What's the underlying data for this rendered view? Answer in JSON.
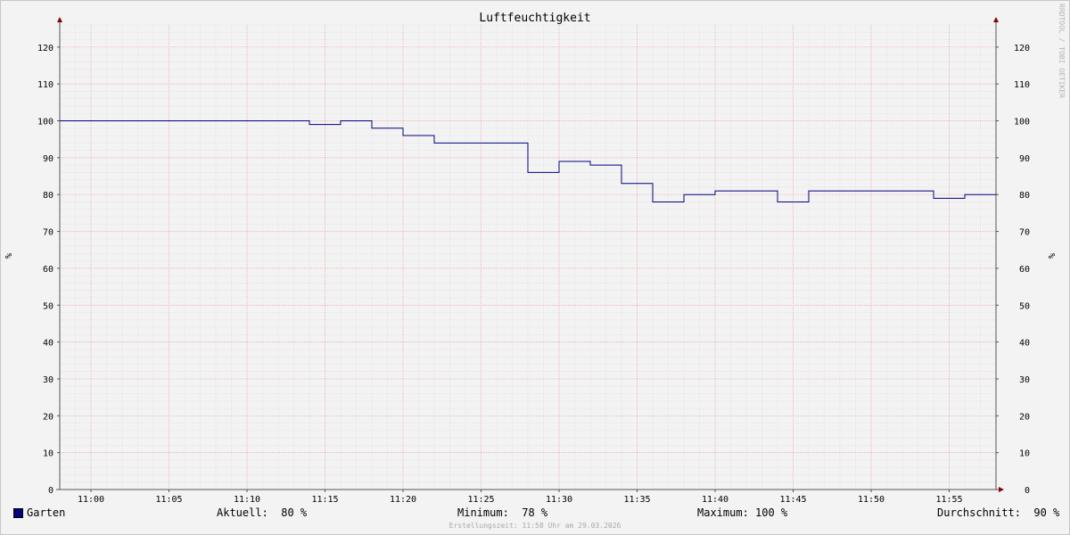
{
  "chart_data": {
    "type": "line",
    "title": "Luftfeuchtigkeit",
    "ylabel": "%",
    "watermark": "RRDTOOL / TOBI OETIKER",
    "ylim": [
      0,
      126
    ],
    "y_ticks": [
      0,
      10,
      20,
      30,
      40,
      50,
      60,
      70,
      80,
      90,
      100,
      110,
      120
    ],
    "x_range": [
      "10:58",
      "11:58"
    ],
    "x_ticks": [
      "11:00",
      "11:05",
      "11:10",
      "11:15",
      "11:20",
      "11:25",
      "11:30",
      "11:35",
      "11:40",
      "11:45",
      "11:50",
      "11:55"
    ],
    "grid": true,
    "series": [
      {
        "name": "Garten",
        "color": "#000080",
        "step": true,
        "points": [
          [
            "10:58",
            100
          ],
          [
            "11:14",
            99
          ],
          [
            "11:16",
            100
          ],
          [
            "11:18",
            98
          ],
          [
            "11:20",
            96
          ],
          [
            "11:22",
            94
          ],
          [
            "11:28",
            86
          ],
          [
            "11:30",
            89
          ],
          [
            "11:32",
            88
          ],
          [
            "11:34",
            83
          ],
          [
            "11:36",
            78
          ],
          [
            "11:38",
            80
          ],
          [
            "11:40",
            81
          ],
          [
            "11:44",
            78
          ],
          [
            "11:46",
            81
          ],
          [
            "11:48",
            81
          ],
          [
            "11:54",
            79
          ],
          [
            "11:56",
            80
          ],
          [
            "11:58",
            80
          ]
        ]
      }
    ]
  },
  "legend": {
    "name": "Garten",
    "swatch_color": "#000080",
    "current": "Aktuell:  80 %",
    "minimum": "Minimum:  78 %",
    "maximum": "Maximum: 100 %",
    "average": "Durchschnitt:  90 %"
  },
  "footer": "Erstellungszeit: 11:58 Uhr am 29.03.2026"
}
